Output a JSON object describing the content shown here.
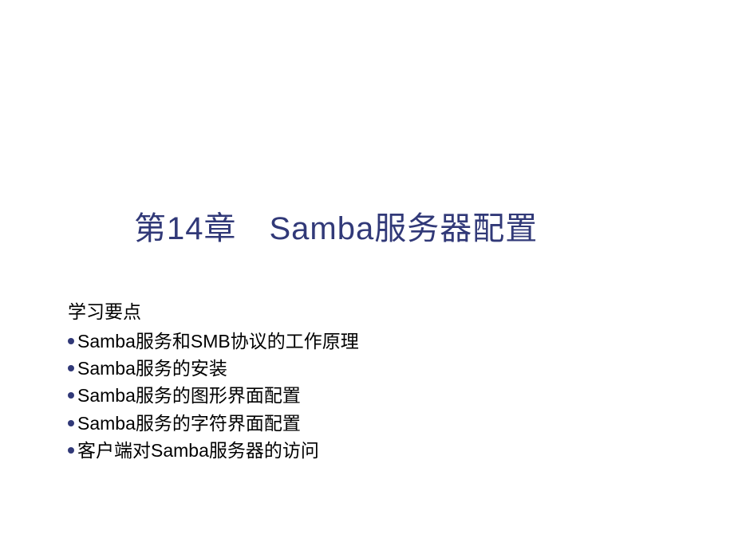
{
  "slide": {
    "title": "第14章　Samba服务器配置",
    "heading": "学习要点",
    "bullets": [
      "Samba服务和SMB协议的工作原理",
      "Samba服务的安装",
      "Samba服务的图形界面配置",
      "Samba服务的字符界面配置",
      "客户端对Samba服务器的访问"
    ]
  }
}
